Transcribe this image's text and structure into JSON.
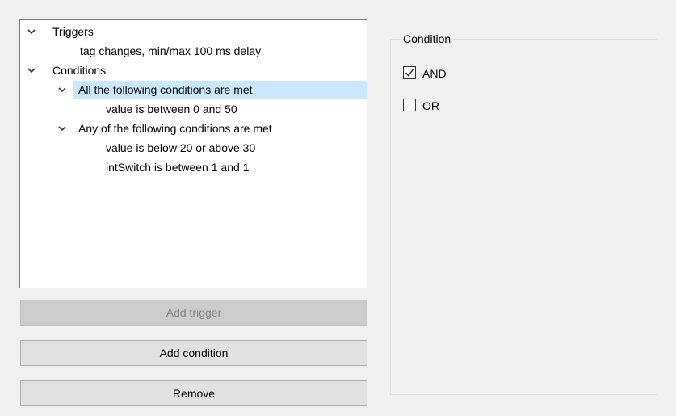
{
  "tree": {
    "items": [
      {
        "label": "Triggers",
        "expanded": true,
        "icon": "chevron-down-icon"
      },
      {
        "label": "tag changes, min/max 100 ms delay"
      },
      {
        "label": "Conditions",
        "expanded": true,
        "icon": "chevron-down-icon"
      },
      {
        "label": "All the following conditions are met",
        "expanded": true,
        "selected": true,
        "icon": "chevron-down-icon"
      },
      {
        "label": "value is between 0 and 50"
      },
      {
        "label": "Any of the following conditions are met",
        "expanded": true,
        "icon": "chevron-down-icon"
      },
      {
        "label": "value is below 20 or above 30"
      },
      {
        "label": "intSwitch is between 1 and 1"
      }
    ]
  },
  "buttons": {
    "add_trigger": "Add trigger",
    "add_condition": "Add condition",
    "remove": "Remove"
  },
  "condition_group": {
    "title": "Condition",
    "options": [
      {
        "label": "AND",
        "checked": true
      },
      {
        "label": "OR",
        "checked": false
      }
    ]
  },
  "colors": {
    "selection": "#cce8ff",
    "background": "#f0f0f0",
    "disabled_button": "#cccccc"
  }
}
